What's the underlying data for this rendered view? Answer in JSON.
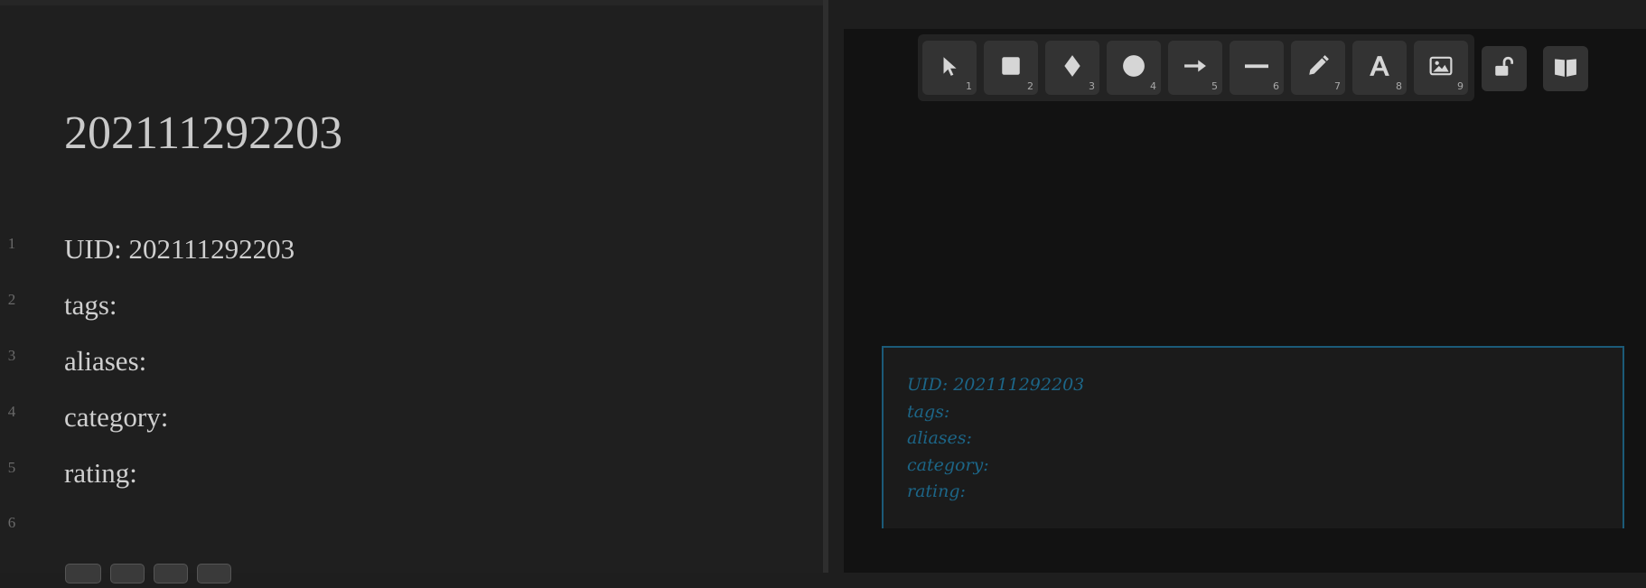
{
  "editor": {
    "title": "202111292203",
    "lines": [
      {
        "num": "1",
        "text": "UID: 202111292203"
      },
      {
        "num": "2",
        "text": "tags:"
      },
      {
        "num": "3",
        "text": "aliases:"
      },
      {
        "num": "4",
        "text": "category:"
      },
      {
        "num": "5",
        "text": "rating:"
      },
      {
        "num": "6",
        "text": ""
      }
    ]
  },
  "toolbar": {
    "tools": [
      {
        "icon": "pointer-icon",
        "key": "1"
      },
      {
        "icon": "square-icon",
        "key": "2"
      },
      {
        "icon": "diamond-icon",
        "key": "3"
      },
      {
        "icon": "circle-icon",
        "key": "4"
      },
      {
        "icon": "arrow-icon",
        "key": "5"
      },
      {
        "icon": "line-icon",
        "key": "6"
      },
      {
        "icon": "pencil-icon",
        "key": "7"
      },
      {
        "icon": "text-icon",
        "key": "8"
      },
      {
        "icon": "image-icon",
        "key": "9"
      }
    ],
    "lock_icon": "unlock-icon",
    "library_icon": "book-icon"
  },
  "embed": {
    "lines": [
      "UID: 202111292203",
      "tags:",
      "aliases:",
      "category:",
      "rating:"
    ],
    "border_color": "#1b5a78",
    "text_color": "#1c6688"
  }
}
